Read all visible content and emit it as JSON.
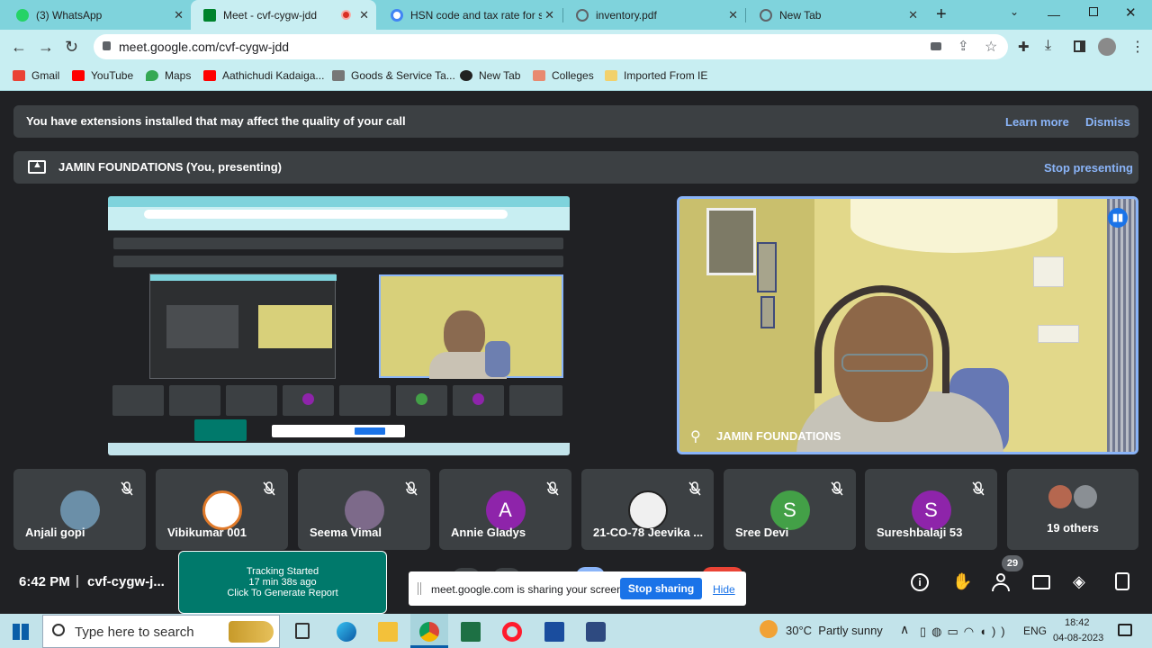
{
  "tabs": [
    {
      "label": "(3) WhatsApp",
      "icon": "whatsapp-icon"
    },
    {
      "label": "Meet - cvf-cygw-jdd",
      "icon": "meet-icon"
    },
    {
      "label": "HSN code and tax rate for sc",
      "icon": "google-icon"
    },
    {
      "label": "inventory.pdf",
      "icon": "globe-icon"
    },
    {
      "label": "New Tab",
      "icon": "chrome-icon"
    }
  ],
  "address": {
    "url": "meet.google.com/cvf-cygw-jdd"
  },
  "bookmarks": [
    "Gmail",
    "YouTube",
    "Maps",
    "Aathichudi Kadaiga...",
    "Goods & Service Ta...",
    "New Tab",
    "Colleges",
    "Imported From IE"
  ],
  "banner": {
    "warning": "You have extensions installed that may affect the quality of your call",
    "learn_more": "Learn more",
    "dismiss": "Dismiss"
  },
  "present": {
    "label": "JAMIN FOUNDATIONS (You, presenting)",
    "stop": "Stop presenting"
  },
  "pinned": {
    "name": "JAMIN FOUNDATIONS"
  },
  "participants": [
    {
      "name": "Anjali gopi",
      "type": "photo",
      "color": "#6b8fa8"
    },
    {
      "name": "Vibikumar 001",
      "type": "photo",
      "color": "#e07a2a"
    },
    {
      "name": "Seema Vimal",
      "type": "photo",
      "color": "#7d6a8a"
    },
    {
      "name": "Annie Gladys",
      "type": "letter",
      "letter": "A",
      "color": "#8e24aa"
    },
    {
      "name": "21-CO-78 Jeevika ...",
      "type": "photo",
      "color": "#555555"
    },
    {
      "name": "Sree Devi",
      "type": "letter",
      "letter": "S",
      "color": "#43a047"
    },
    {
      "name": "Sureshbalaji 53",
      "type": "letter",
      "letter": "S",
      "color": "#8e24aa"
    }
  ],
  "others": "19 others",
  "bottom": {
    "time": "6:42 PM",
    "separator": "|",
    "code": "cvf-cygw-j...",
    "people_count": "29"
  },
  "tracking": {
    "line1": "Tracking Started",
    "line2": "17 min 38s ago",
    "line3": "Click To Generate Report"
  },
  "sharing": {
    "text": "meet.google.com is sharing your screen.",
    "stop": "Stop sharing",
    "hide": "Hide"
  },
  "taskbar": {
    "search": "Type here to search",
    "weather": "30°C  Partly sunny",
    "lang": "ENG",
    "time": "18:42",
    "date": "04-08-2023"
  },
  "colors": {
    "accent": "#8ab4f8",
    "teal": "#00796b",
    "chrome": "#7fd3dc"
  }
}
